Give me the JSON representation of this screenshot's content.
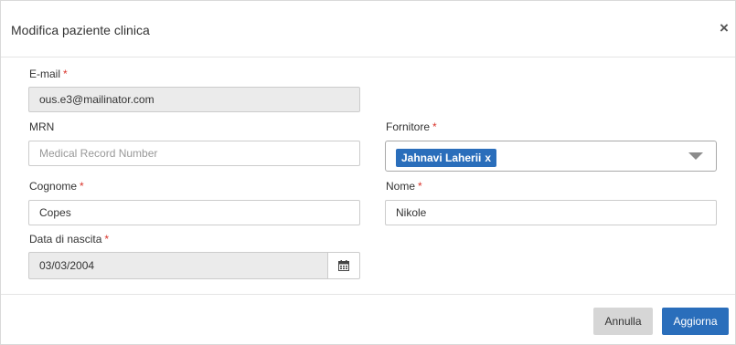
{
  "modal": {
    "title": "Modifica paziente clinica",
    "close_glyph": "×"
  },
  "required_mark": "*",
  "fields": {
    "email": {
      "label": "E-mail",
      "value": "ous.e3@mailinator.com"
    },
    "mrn": {
      "label": "MRN",
      "placeholder": "Medical Record Number"
    },
    "provider": {
      "label": "Fornitore",
      "selected_tag": "Jahnavi Laherii",
      "remove_glyph": "x"
    },
    "last_name": {
      "label": "Cognome",
      "value": "Copes"
    },
    "first_name": {
      "label": "Nome",
      "value": "Nikole"
    },
    "birth_date": {
      "label": "Data di nascita",
      "value": "03/03/2004"
    }
  },
  "footer": {
    "cancel_label": "Annulla",
    "update_label": "Aggiorna"
  },
  "colors": {
    "primary": "#2a6ebb",
    "required": "#d9342b",
    "readonly_bg": "#ebebeb"
  },
  "icons": {
    "close": "close-icon",
    "dropdown": "chevron-down-icon",
    "calendar": "calendar-icon"
  }
}
